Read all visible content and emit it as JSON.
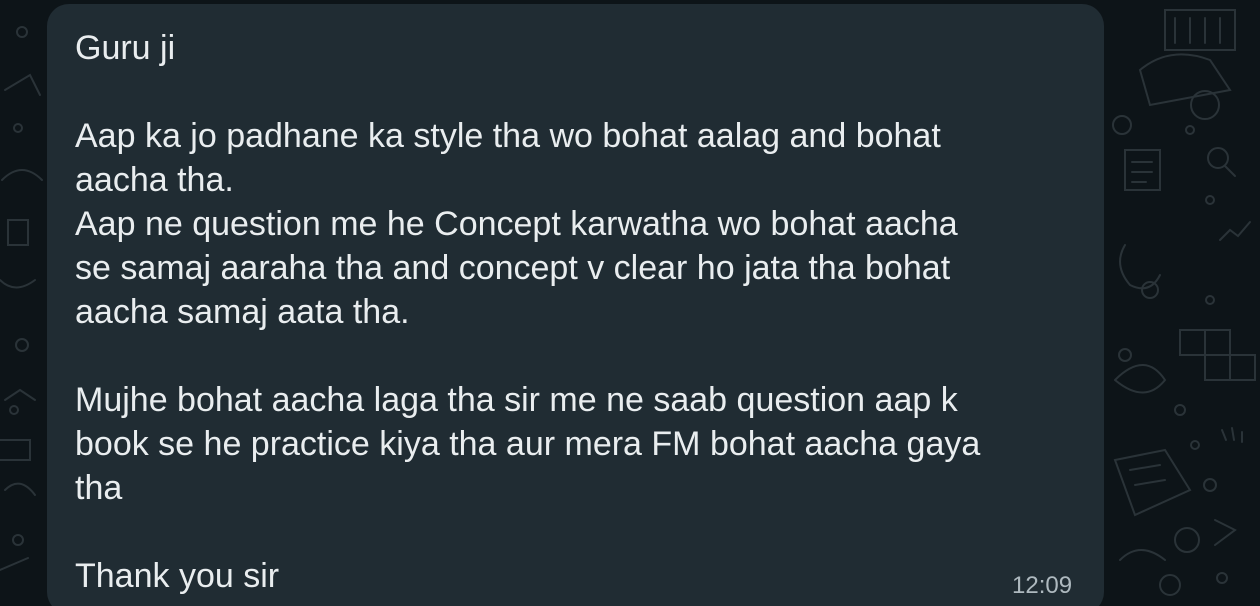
{
  "message": {
    "lines": [
      "Guru ji",
      "",
      "Aap ka jo padhane ka style tha wo bohat aalag and bohat",
      "aacha tha.",
      "Aap ne question me he Concept karwatha wo bohat aacha",
      "se samaj aaraha tha and concept v clear ho jata tha bohat",
      "aacha samaj aata tha.",
      "",
      "Mujhe bohat aacha laga tha sir me ne saab question aap k",
      "book se he practice kiya tha aur mera FM bohat aacha gaya",
      "tha",
      "",
      "Thank you sir"
    ],
    "time": "12:09"
  },
  "theme": {
    "bubble_color": "#202c33",
    "background_color": "#0d1418",
    "text_color": "#e9edef",
    "time_color": "#aeb9bf"
  }
}
